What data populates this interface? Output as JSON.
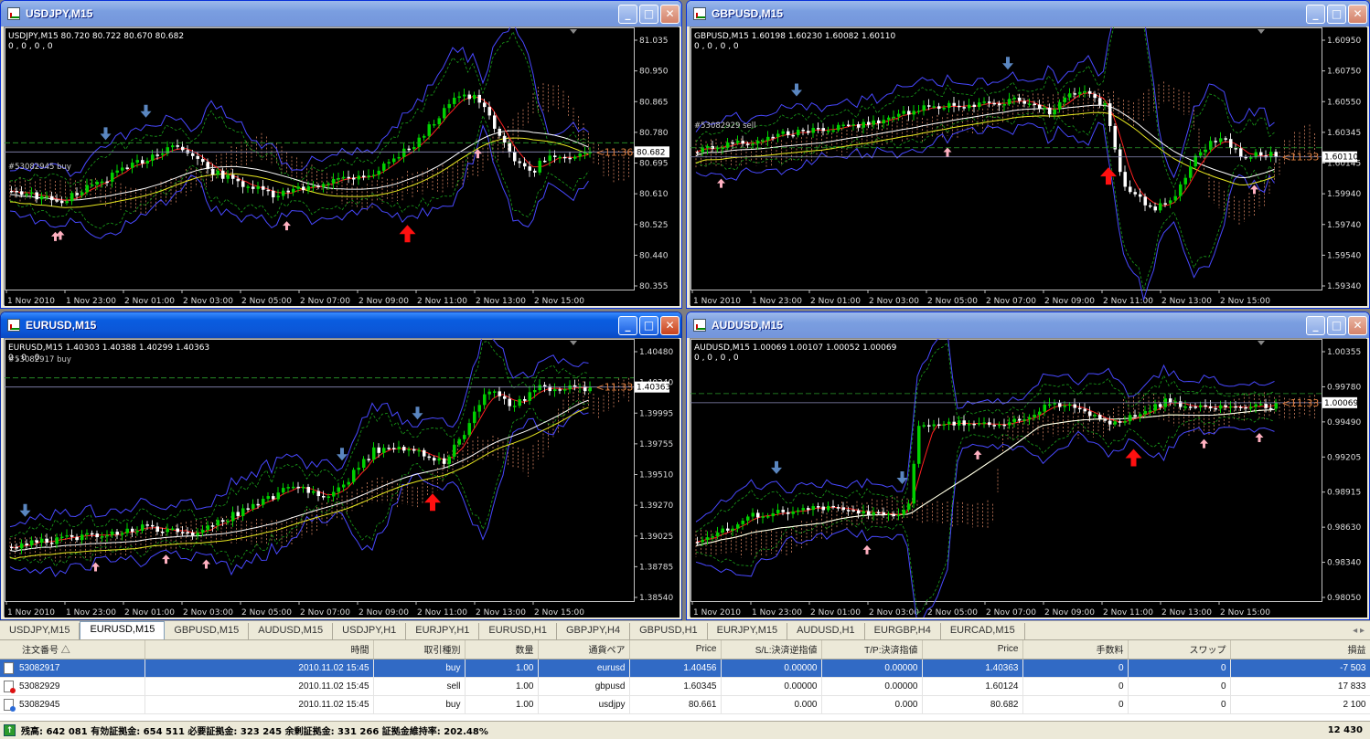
{
  "charts": [
    {
      "id": "usdjpy",
      "title": "USDJPY,M15",
      "info": "USDJPY,M15  80.720 80.722 80.670 80.682",
      "sub": "0 , 0 , 0 , 0",
      "order": "#53082945 buy",
      "timer": "<11:36",
      "price": "80.682",
      "yticks": [
        "81.035",
        "80.950",
        "80.865",
        "80.780",
        "80.695",
        "80.610",
        "80.525",
        "80.440",
        "80.355"
      ],
      "xticks": [
        "1 Nov 2010",
        "1 Nov 23:00",
        "2 Nov 01:00",
        "2 Nov 03:00",
        "2 Nov 05:00",
        "2 Nov 07:00",
        "2 Nov 09:00",
        "2 Nov 11:00",
        "2 Nov 13:00",
        "2 Nov 15:00"
      ]
    },
    {
      "id": "gbpusd",
      "title": "GBPUSD,M15",
      "info": "GBPUSD,M15  1.60198 1.60230 1.60082 1.60110",
      "sub": "0 , 0 , 0 , 0",
      "order": "#53082929 sell",
      "timer": "<11:33",
      "price": "1.60110",
      "yticks": [
        "1.60950",
        "1.60750",
        "1.60550",
        "1.60345",
        "1.60145",
        "1.59940",
        "1.59740",
        "1.59540",
        "1.59340"
      ],
      "xticks": [
        "1 Nov 2010",
        "1 Nov 23:00",
        "2 Nov 01:00",
        "2 Nov 03:00",
        "2 Nov 05:00",
        "2 Nov 07:00",
        "2 Nov 09:00",
        "2 Nov 11:00",
        "2 Nov 13:00",
        "2 Nov 15:00"
      ]
    },
    {
      "id": "eurusd",
      "title": "EURUSD,M15",
      "info": "EURUSD,M15  1.40303 1.40388 1.40299 1.40363",
      "sub": "0 , 0 , 0",
      "order": "#53082917 buy",
      "timer": "<11:33",
      "price": "1.40363",
      "yticks": [
        "1.40480",
        "1.40240",
        "1.39995",
        "1.39755",
        "1.39510",
        "1.39270",
        "1.39025",
        "1.38785",
        "1.38540"
      ],
      "xticks": [
        "1 Nov 2010",
        "1 Nov 23:00",
        "2 Nov 01:00",
        "2 Nov 03:00",
        "2 Nov 05:00",
        "2 Nov 07:00",
        "2 Nov 09:00",
        "2 Nov 11:00",
        "2 Nov 13:00",
        "2 Nov 15:00"
      ]
    },
    {
      "id": "audusd",
      "title": "AUDUSD,M15",
      "info": "AUDUSD,M15  1.00069 1.00107 1.00052 1.00069",
      "sub": "0 , 0 , 0 , 0",
      "order": "",
      "timer": "<11:33",
      "price": "1.00069",
      "yticks": [
        "1.00355",
        "0.99780",
        "0.99490",
        "0.99205",
        "0.98915",
        "0.98630",
        "0.98340",
        "0.98050"
      ],
      "xticks": [
        "1 Nov 2010",
        "1 Nov 23:00",
        "2 Nov 01:00",
        "2 Nov 03:00",
        "2 Nov 05:00",
        "2 Nov 07:00",
        "2 Nov 09:00",
        "2 Nov 11:00",
        "2 Nov 13:00",
        "2 Nov 15:00"
      ]
    }
  ],
  "window_buttons": {
    "minimize": "_",
    "maximize": "□",
    "close": "✕"
  },
  "tabs": [
    "USDJPY,M15",
    "EURUSD,M15",
    "GBPUSD,M15",
    "AUDUSD,M15",
    "USDJPY,H1",
    "EURJPY,H1",
    "EURUSD,H1",
    "GBPJPY,H4",
    "GBPUSD,H1",
    "EURJPY,M15",
    "AUDUSD,H1",
    "EURGBP,H4",
    "EURCAD,M15"
  ],
  "active_tab": 1,
  "tab_nav": "◂ ▸",
  "columns": [
    "注文番号",
    "時間",
    "取引種別",
    "数量",
    "通貨ペア",
    "Price",
    "S/L:決済逆指値",
    "T/P:決済指値",
    "Price",
    "手数料",
    "スワップ",
    "損益"
  ],
  "sort_marker": "△",
  "orders": [
    [
      "53082917",
      "2010.11.02 15:45",
      "buy",
      "1.00",
      "eurusd",
      "1.40456",
      "0.00000",
      "0.00000",
      "1.40363",
      "0",
      "0",
      "-7 503"
    ],
    [
      "53082929",
      "2010.11.02 15:45",
      "sell",
      "1.00",
      "gbpusd",
      "1.60345",
      "0.00000",
      "0.00000",
      "1.60124",
      "0",
      "0",
      "17 833"
    ],
    [
      "53082945",
      "2010.11.02 15:45",
      "buy",
      "1.00",
      "usdjpy",
      "80.661",
      "0.000",
      "0.000",
      "80.682",
      "0",
      "0",
      "2 100"
    ]
  ],
  "balance_line": "残高: 642 081  有効証拠金: 654 511  必要証拠金: 323 245  余剰証拠金: 331 266  証拠金維持率: 202.48%",
  "total": "12 430",
  "colors": {
    "candle_up": "#00d000",
    "candle_down": "#ffffff",
    "bollinger": "#4848ff",
    "ma_fast": "#ff2020",
    "ma_slow": "#ffffff",
    "ma_long": "#e8e820",
    "cloud": "#d08060",
    "arrow_sell": "#5a86c0",
    "arrow_buy": "#ff1010",
    "arrow_small_buy": "#ffb0c0"
  }
}
